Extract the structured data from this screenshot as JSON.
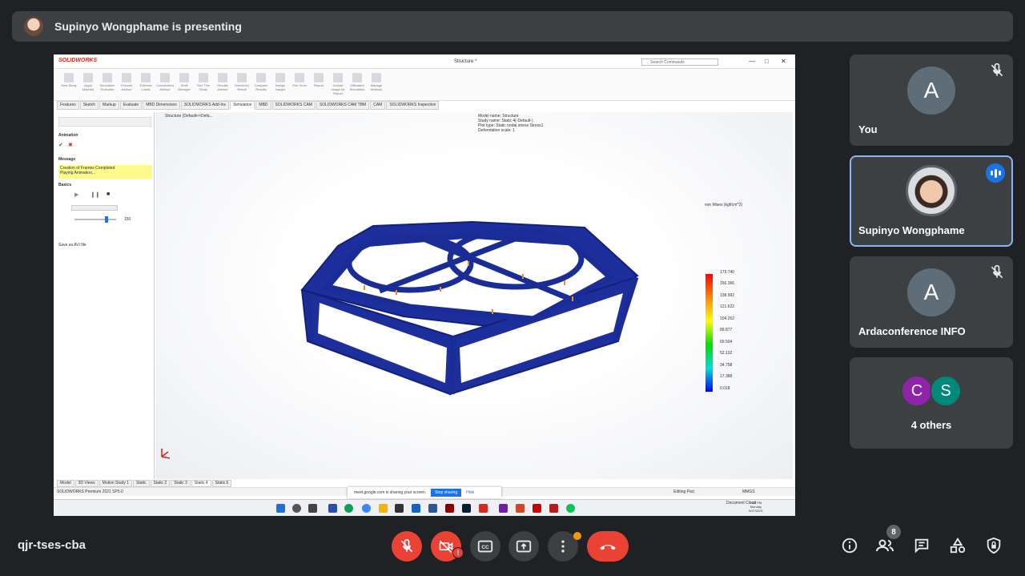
{
  "banner": {
    "presenting_text": "Supinyo Wongphame is presenting",
    "avatar_icon": "presenter-avatar"
  },
  "shared_screen": {
    "app_logo": "SOLIDWORKS",
    "doc_title": "Structure *",
    "search_placeholder": "Search Commands",
    "ribbon_items": [
      "New Study",
      "Apply Material",
      "Simulation Evaluator",
      "Fixtures Advisor",
      "External Loads",
      "Connections Advisor",
      "Shell Manager",
      "Run This Study",
      "Results Advisor",
      "Deformed Result",
      "Compare Results",
      "Design Insight",
      "Plot Tools",
      "Report",
      "Include Image for Report",
      "Offloaded Simulation",
      "Manage Network"
    ],
    "command_tabs": [
      "Features",
      "Sketch",
      "Markup",
      "Evaluate",
      "MBD Dimensions",
      "SOLIDWORKS Add-Ins",
      "Simulation",
      "MBD",
      "SOLIDWORKS CAM",
      "SOLIDWORKS CAM TBM",
      "CAM",
      "SOLIDWORKS Inspection"
    ],
    "active_tab": "Simulation",
    "left_panel": {
      "title": "Animation",
      "message_header": "Message",
      "message_lines": [
        "Creation of Frames Completed",
        "Playing Animation..."
      ],
      "basics_header": "Basics",
      "frames_value": "150",
      "save_label": "Save as AVI file"
    },
    "tree_label": "Structure (Default<<Defa...",
    "model_info": [
      "Model name: Structure",
      "Study name: Static 4(-Default-)",
      "Plot type: Static nodal stress Stress1",
      "Deformation scale: 1"
    ],
    "legend_title": "von Mises (kgf/cm^2)",
    "legend_values": [
      "173.740",
      "156.366",
      "138.992",
      "121.622",
      "104.252",
      "86.877",
      "69.504",
      "52.132",
      "34.758",
      "17.388",
      "0.018"
    ],
    "bottom_tabs": [
      "Model",
      "3D Views",
      "Motion Study 1",
      "Static",
      "Static 2",
      "Static 3",
      "Static 4",
      "Static 5"
    ],
    "active_bottom_tab": "Static 4",
    "status_left": "SOLIDWORKS Premium 2021 SP5.0",
    "status_right": "Editing Part",
    "status_units": "MMGS",
    "share_text": "meet.google.com is sharing your screen.",
    "stop_sharing": "Stop sharing",
    "hide": "Hide",
    "taskbar_time": "2:32 PM",
    "taskbar_day": "Monday",
    "taskbar_date": "9/27/2021",
    "taskbar_doc": "Document Cloud"
  },
  "participants": [
    {
      "name": "You",
      "initial": "A",
      "muted": true,
      "avatar_color": "#5f6d79"
    },
    {
      "name": "Supinyo Wongphame",
      "speaking": true
    },
    {
      "name": "Ardaconference INFO",
      "initial": "A",
      "muted": true,
      "avatar_color": "#5f6d79"
    },
    {
      "others_label": "4 others",
      "initials": [
        "C",
        "S"
      ],
      "colors": [
        "#8e24aa",
        "#00897b"
      ]
    }
  ],
  "controls": {
    "meeting_code": "qjr-tses-cba",
    "camera_alert": "!",
    "people_count": "8"
  },
  "colors": {
    "background": "#202124",
    "tile": "#3c4043",
    "danger": "#ea4335",
    "accent": "#8ab4f8",
    "speaking": "#1a73e8"
  }
}
